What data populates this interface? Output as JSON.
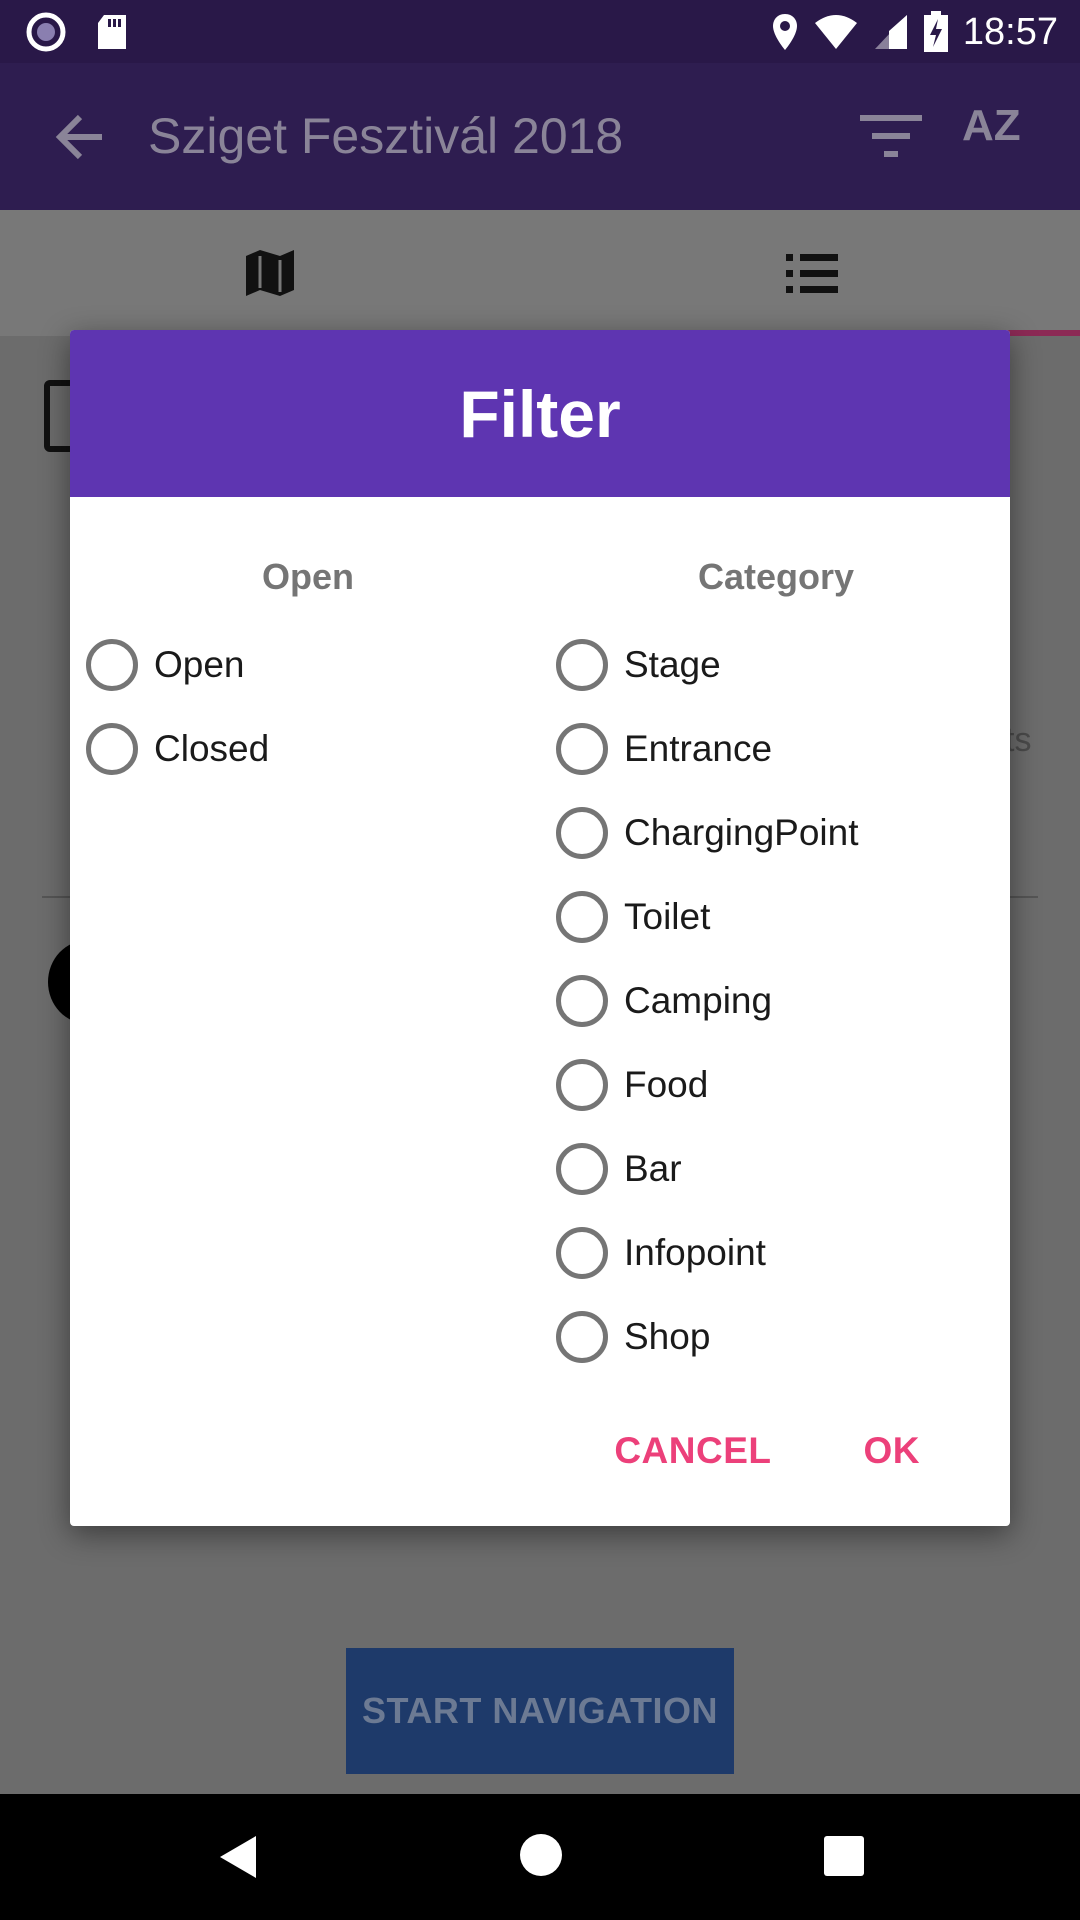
{
  "status_bar": {
    "time": "18:57"
  },
  "app_bar": {
    "title": "Sziget Fesztivál 2018",
    "sort_label": "AZ"
  },
  "background": {
    "peek_text": "ts",
    "start_navigation": "START NAVIGATION"
  },
  "dialog": {
    "title": "Filter",
    "open_column": {
      "heading": "Open",
      "options": [
        {
          "label": "Open"
        },
        {
          "label": "Closed"
        }
      ]
    },
    "category_column": {
      "heading": "Category",
      "options": [
        {
          "label": "Stage"
        },
        {
          "label": "Entrance"
        },
        {
          "label": "ChargingPoint"
        },
        {
          "label": "Toilet"
        },
        {
          "label": "Camping"
        },
        {
          "label": "Food"
        },
        {
          "label": "Bar"
        },
        {
          "label": "Infopoint"
        },
        {
          "label": "Shop"
        }
      ]
    },
    "cancel_label": "CANCEL",
    "ok_label": "OK"
  },
  "colors": {
    "header": "#5e35b1",
    "accent": "#ec407a",
    "appbar": "#2e1d50"
  }
}
